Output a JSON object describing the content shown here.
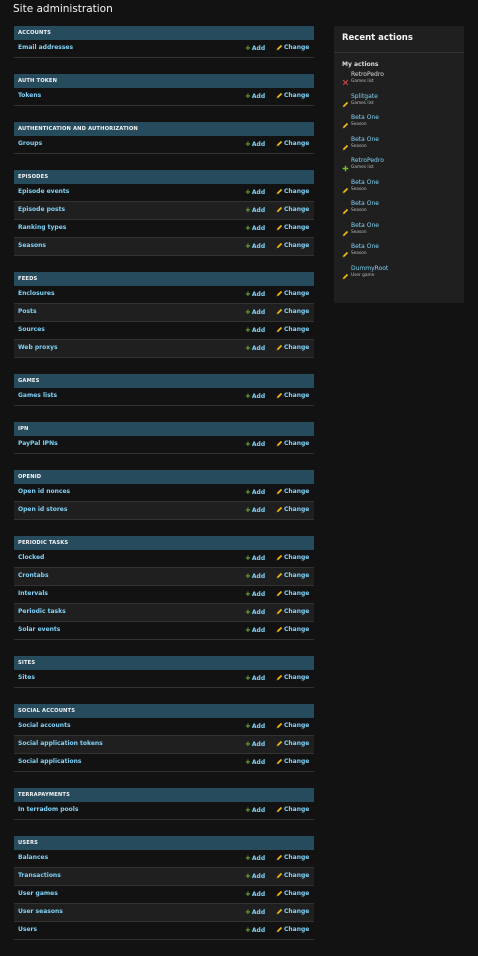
{
  "page_title": "Site administration",
  "row_add_label": "Add",
  "row_change_label": "Change",
  "apps": [
    {
      "caption": "Accounts",
      "models": [
        "Email addresses"
      ]
    },
    {
      "caption": "Auth Token",
      "models": [
        "Tokens"
      ]
    },
    {
      "caption": "Authentication and Authorization",
      "models": [
        "Groups"
      ]
    },
    {
      "caption": "Episodes",
      "models": [
        "Episode events",
        "Episode posts",
        "Ranking types",
        "Seasons"
      ]
    },
    {
      "caption": "Feeds",
      "models": [
        "Enclosures",
        "Posts",
        "Sources",
        "Web proxys"
      ]
    },
    {
      "caption": "Games",
      "models": [
        "Games lists"
      ]
    },
    {
      "caption": "IPN",
      "models": [
        "PayPal IPNs"
      ]
    },
    {
      "caption": "OpenID",
      "models": [
        "Open id nonces",
        "Open id stores"
      ]
    },
    {
      "caption": "Periodic Tasks",
      "models": [
        "Clocked",
        "Crontabs",
        "Intervals",
        "Periodic tasks",
        "Solar events"
      ]
    },
    {
      "caption": "Sites",
      "models": [
        "Sites"
      ]
    },
    {
      "caption": "Social Accounts",
      "models": [
        "Social accounts",
        "Social application tokens",
        "Social applications"
      ]
    },
    {
      "caption": "Terrapayments",
      "models": [
        "In terradom pools"
      ]
    },
    {
      "caption": "Users",
      "models": [
        "Balances",
        "Transactions",
        "User games",
        "User seasons",
        "Users"
      ]
    }
  ],
  "recent_actions": {
    "title": "Recent actions",
    "my_actions_title": "My actions",
    "items": [
      {
        "name": "RetroPedro",
        "type": "Games list",
        "action": "delete"
      },
      {
        "name": "Splitgate",
        "type": "Games list",
        "action": "change"
      },
      {
        "name": "Beta One",
        "type": "Season",
        "action": "change"
      },
      {
        "name": "Beta One",
        "type": "Season",
        "action": "change"
      },
      {
        "name": "RetroPedro",
        "type": "Games list",
        "action": "add"
      },
      {
        "name": "Beta One",
        "type": "Season",
        "action": "change"
      },
      {
        "name": "Beta One",
        "type": "Season",
        "action": "change"
      },
      {
        "name": "Beta One",
        "type": "Season",
        "action": "change"
      },
      {
        "name": "Beta One",
        "type": "Season",
        "action": "change"
      },
      {
        "name": "DummyRoot",
        "type": "User game",
        "action": "change"
      }
    ]
  },
  "colors": {
    "background": "#121212",
    "caption_bg": "#264b5d",
    "link": "#81d4fa",
    "add_icon": "#70bf2b",
    "change_icon": "#efb80b",
    "delete_icon": "#dd4646"
  }
}
